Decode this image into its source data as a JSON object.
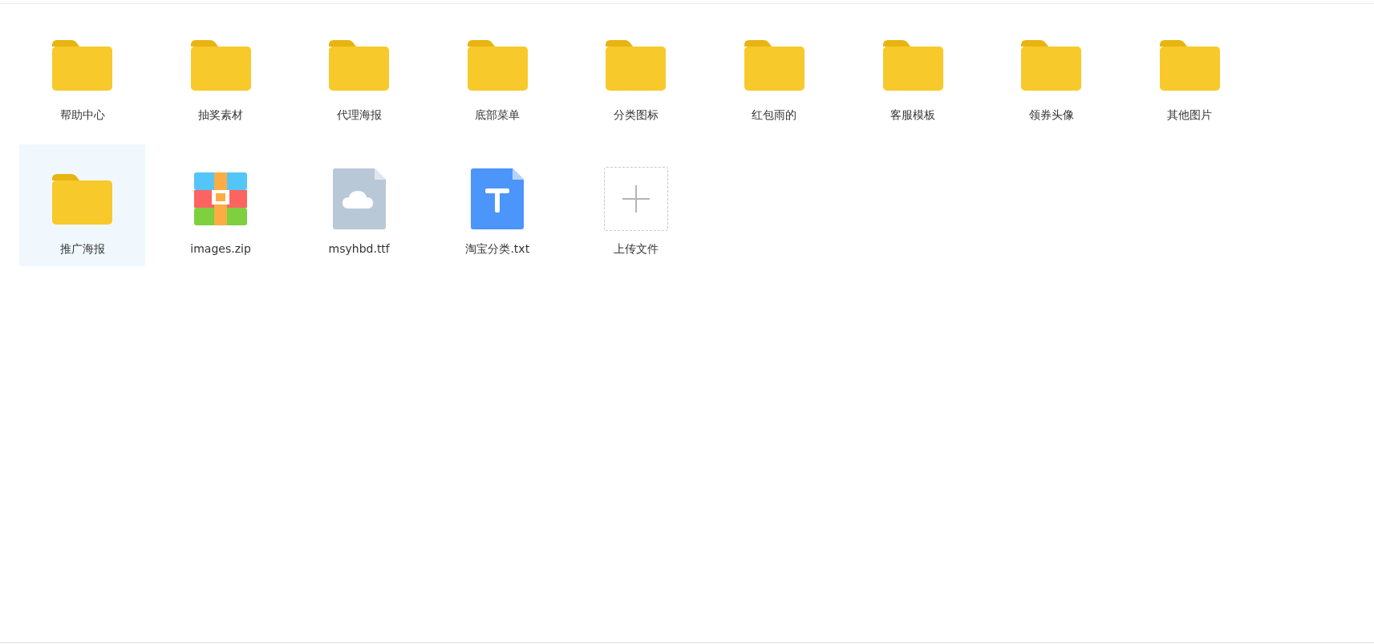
{
  "items": [
    {
      "kind": "folder",
      "name": "帮助中心",
      "selected": false
    },
    {
      "kind": "folder",
      "name": "抽奖素材",
      "selected": false
    },
    {
      "kind": "folder",
      "name": "代理海报",
      "selected": false
    },
    {
      "kind": "folder",
      "name": "底部菜单",
      "selected": false
    },
    {
      "kind": "folder",
      "name": "分类图标",
      "selected": false
    },
    {
      "kind": "folder",
      "name": "红包雨的",
      "selected": false
    },
    {
      "kind": "folder",
      "name": "客服模板",
      "selected": false
    },
    {
      "kind": "folder",
      "name": "领券头像",
      "selected": false
    },
    {
      "kind": "folder",
      "name": "其他图片",
      "selected": false
    },
    {
      "kind": "folder",
      "name": "推广海报",
      "selected": true
    },
    {
      "kind": "zip",
      "name": "images.zip",
      "selected": false
    },
    {
      "kind": "font",
      "name": "msyhbd.ttf",
      "selected": false
    },
    {
      "kind": "text",
      "name": "淘宝分类.txt",
      "selected": false
    },
    {
      "kind": "upload",
      "name": "上传文件",
      "selected": false
    }
  ]
}
